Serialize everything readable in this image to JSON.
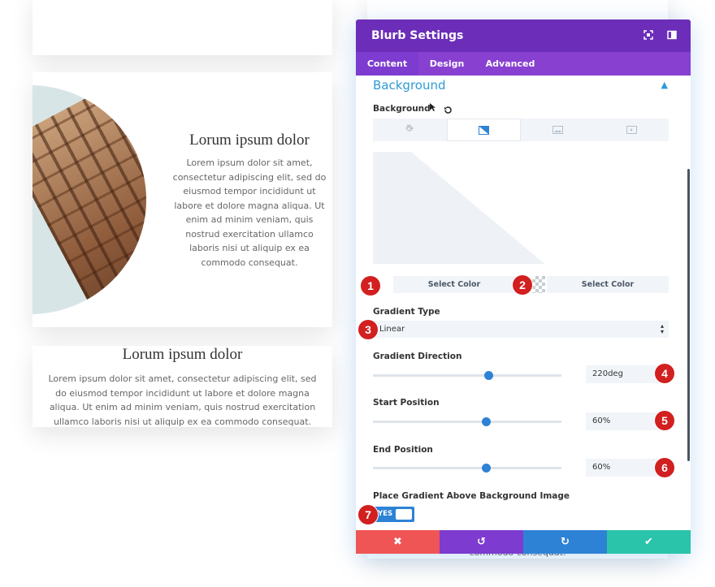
{
  "left": {
    "card2": {
      "title": "Lorum ipsum dolor",
      "text": "Lorem ipsum dolor sit amet, consectetur adipiscing elit, sed do eiusmod tempor incididunt ut labore et dolore magna aliqua. Ut enim ad minim veniam, quis nostrud exercitation ullamco laboris nisi ut aliquip ex ea commodo consequat."
    },
    "card3": {
      "title": "Lorum ipsum dolor",
      "text": "Lorem ipsum dolor sit amet, consectetur adipiscing elit, sed do eiusmod tempor incididunt ut labore et dolore magna aliqua. Ut enim ad minim veniam, quis nostrud exercitation ullamco laboris nisi ut aliquip ex ea commodo consequat."
    },
    "peek_text": "commodo consequat."
  },
  "panel": {
    "title": "Blurb Settings",
    "header_icons": [
      "expand-icon",
      "sidebar-toggle-icon"
    ],
    "tabs": [
      {
        "label": "Content",
        "active": true
      },
      {
        "label": "Design",
        "active": false
      },
      {
        "label": "Advanced",
        "active": false
      }
    ],
    "section": {
      "title": "Background",
      "background_label": "Background",
      "background_types": [
        "no-background-icon",
        "gradient-icon",
        "image-icon",
        "video-icon"
      ],
      "active_type": "gradient-icon"
    },
    "gradient": {
      "select_color_1": "Select Color",
      "select_color_2": "Select Color",
      "type_label": "Gradient Type",
      "type_value": "Linear",
      "direction_label": "Gradient Direction",
      "direction_value": "220deg",
      "direction_slider": 0.61,
      "start_label": "Start Position",
      "start_value": "60%",
      "start_slider": 0.6,
      "end_label": "End Position",
      "end_value": "60%",
      "end_slider": 0.6,
      "above_label": "Place Gradient Above Background Image",
      "above_toggle": "YES"
    },
    "footer": [
      {
        "name": "cancel-button",
        "icon": "✖",
        "color": "#ef5555"
      },
      {
        "name": "undo-button",
        "icon": "↺",
        "color": "#7e3bd0"
      },
      {
        "name": "redo-button",
        "icon": "↻",
        "color": "#2e82d6"
      },
      {
        "name": "save-button",
        "icon": "✔",
        "color": "#29c4a9"
      }
    ]
  },
  "markers": [
    "1",
    "2",
    "3",
    "4",
    "5",
    "6",
    "7"
  ],
  "colors": {
    "header": "#6c2eb9",
    "tabs": "#8740d0",
    "accent": "#2e9ad6",
    "marker": "#d21f1f"
  }
}
